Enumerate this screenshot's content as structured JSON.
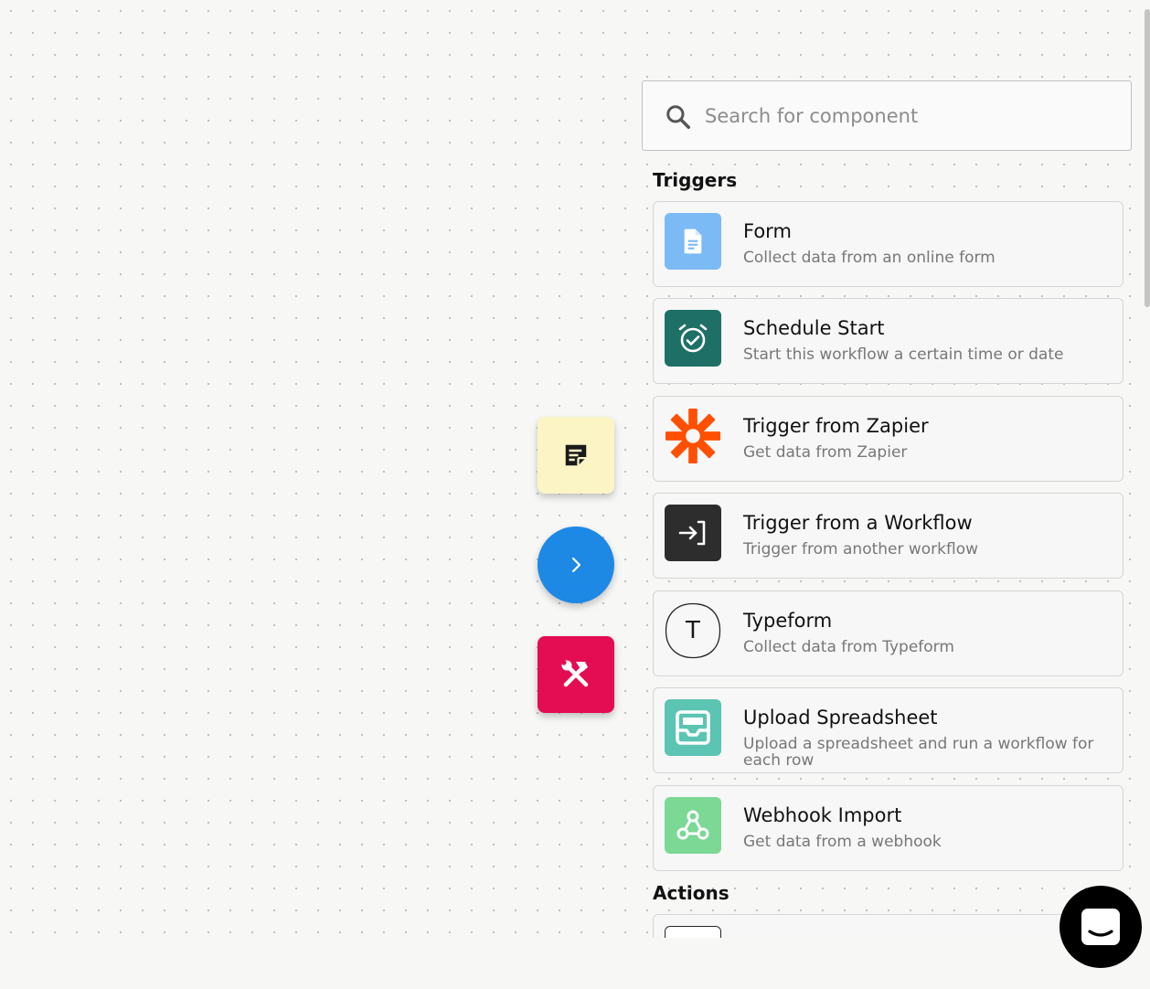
{
  "search": {
    "placeholder": "Search for component"
  },
  "sections": {
    "triggers_title": "Triggers",
    "actions_title": "Actions"
  },
  "triggers": [
    {
      "title": "Form",
      "description": "Collect data from an online form",
      "icon": "document-icon",
      "color": "#7cbaf5"
    },
    {
      "title": "Schedule Start",
      "description": "Start this workflow a certain time or date",
      "icon": "alarm-clock-icon",
      "color": "#1e7066"
    },
    {
      "title": "Trigger from Zapier",
      "description": "Get data from Zapier",
      "icon": "zapier-icon",
      "color": "#ff4f00"
    },
    {
      "title": "Trigger from a Workflow",
      "description": "Trigger from another workflow",
      "icon": "enter-icon",
      "color": "#2d2d2d"
    },
    {
      "title": "Typeform",
      "description": "Collect data from Typeform",
      "icon": "typeform-icon",
      "color": "#262627"
    },
    {
      "title": "Upload Spreadsheet",
      "description": "Upload a spreadsheet and run a workflow for each row",
      "icon": "inbox-tray-icon",
      "color": "#5cc4b3"
    },
    {
      "title": "Webhook Import",
      "description": "Get data from a webhook",
      "icon": "webhook-icon",
      "color": "#7bd895"
    }
  ],
  "typeform_letter": "T",
  "floating_buttons": {
    "note": {
      "icon": "sticky-note-icon",
      "color": "#fbf5c6"
    },
    "next": {
      "icon": "chevron-right-icon",
      "color": "#1e88e5"
    },
    "tools": {
      "icon": "hammer-wrench-icon",
      "color": "#e40d54"
    }
  },
  "chat": {
    "icon": "chat-icon",
    "color": "#000000"
  }
}
